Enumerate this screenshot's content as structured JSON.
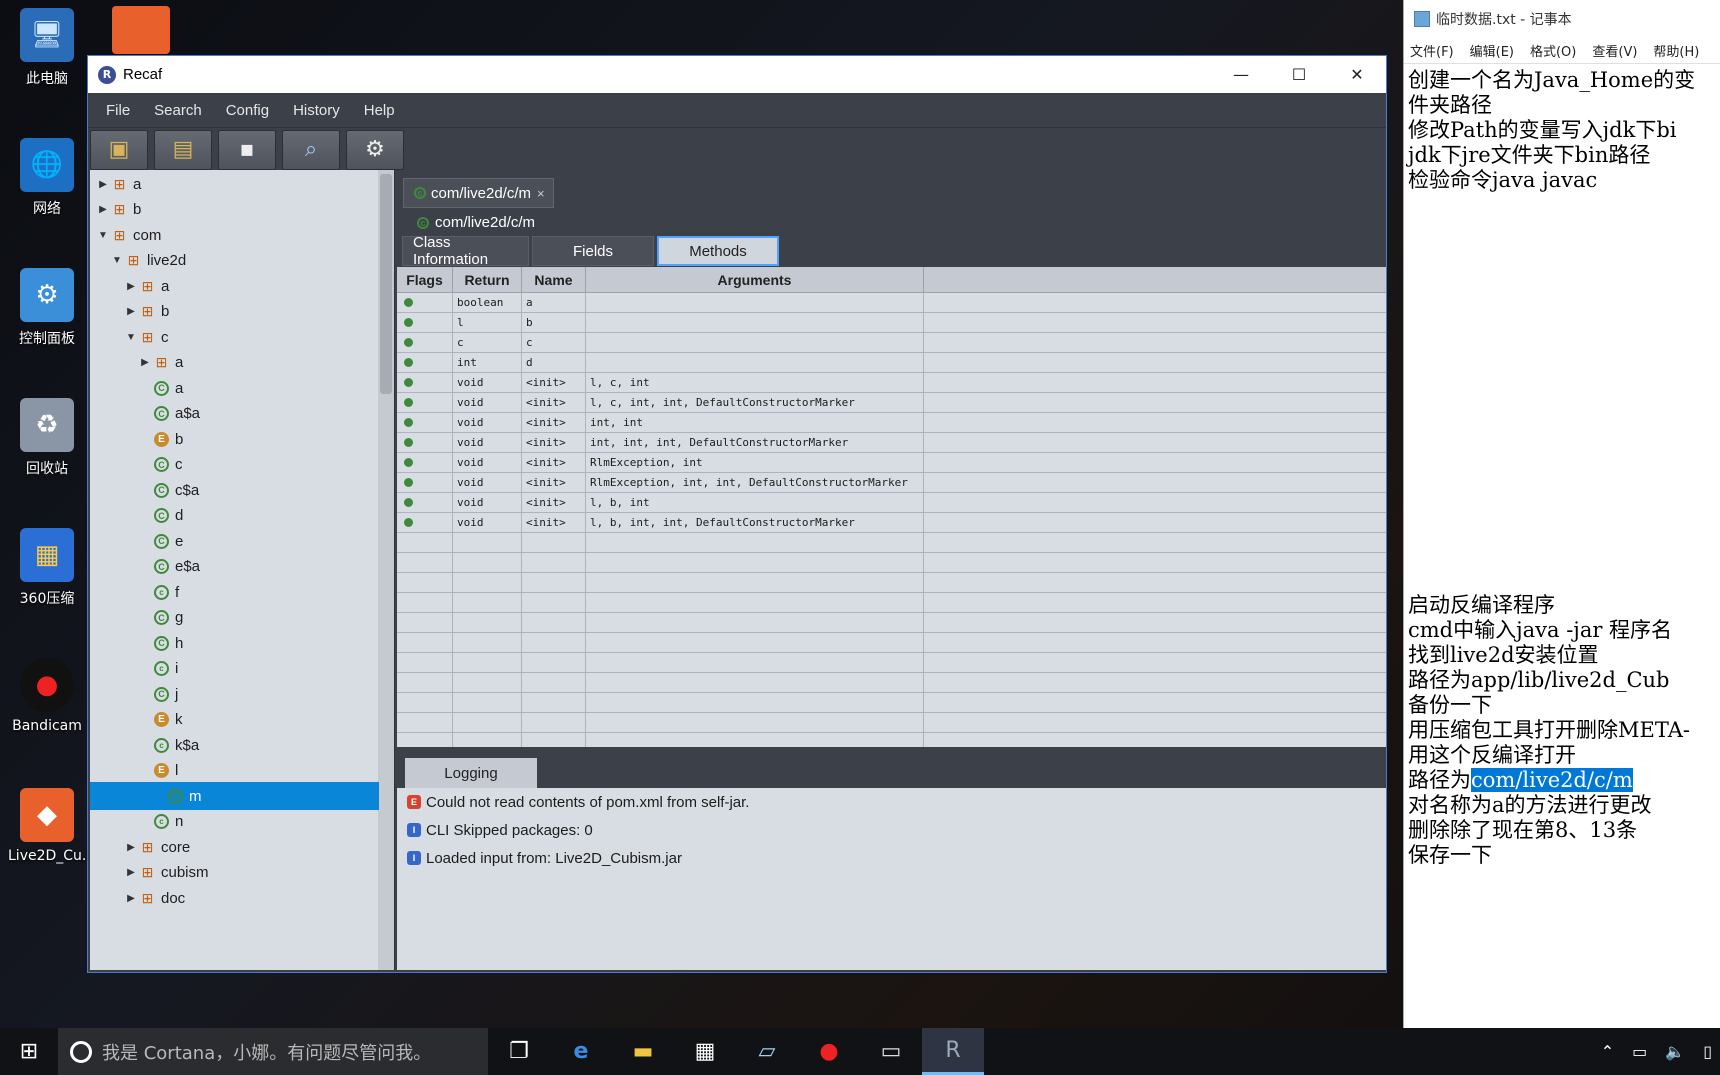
{
  "desktop": {
    "icons": [
      {
        "label": "此电脑",
        "icon": "computer-icon"
      },
      {
        "label": "网络",
        "icon": "network-icon"
      },
      {
        "label": "控制面板",
        "icon": "control-panel-icon"
      },
      {
        "label": "回收站",
        "icon": "recycle-bin-icon"
      },
      {
        "label": "360压缩",
        "icon": "archive-icon"
      },
      {
        "label": "Bandicam",
        "icon": "bandicam-icon"
      },
      {
        "label": "Live2D_Cu...",
        "icon": "live2d-icon"
      }
    ]
  },
  "recaf": {
    "title": "Recaf",
    "window_controls": {
      "minimize": "—",
      "maximize": "☐",
      "close": "✕"
    },
    "menu": [
      "File",
      "Search",
      "Config",
      "History",
      "Help"
    ],
    "toolbar": [
      "load-jar",
      "save-jar",
      "save",
      "search",
      "config"
    ],
    "tree": [
      {
        "label": "a",
        "type": "package",
        "depth": 0,
        "expanded": false
      },
      {
        "label": "b",
        "type": "package",
        "depth": 0,
        "expanded": false
      },
      {
        "label": "com",
        "type": "package",
        "depth": 0,
        "expanded": true
      },
      {
        "label": "live2d",
        "type": "package",
        "depth": 1,
        "expanded": true
      },
      {
        "label": "a",
        "type": "package",
        "depth": 2,
        "expanded": false
      },
      {
        "label": "b",
        "type": "package",
        "depth": 2,
        "expanded": false
      },
      {
        "label": "c",
        "type": "package",
        "depth": 2,
        "expanded": true
      },
      {
        "label": "a",
        "type": "package",
        "depth": 3,
        "expanded": false
      },
      {
        "label": "a",
        "type": "class",
        "depth": 3
      },
      {
        "label": "a$a",
        "type": "class",
        "depth": 3
      },
      {
        "label": "b",
        "type": "enum",
        "depth": 3
      },
      {
        "label": "c",
        "type": "class",
        "depth": 3
      },
      {
        "label": "c$a",
        "type": "class",
        "depth": 3
      },
      {
        "label": "d",
        "type": "class",
        "depth": 3
      },
      {
        "label": "e",
        "type": "class",
        "depth": 3
      },
      {
        "label": "e$a",
        "type": "class",
        "depth": 3
      },
      {
        "label": "f",
        "type": "inner",
        "depth": 3
      },
      {
        "label": "g",
        "type": "class",
        "depth": 3
      },
      {
        "label": "h",
        "type": "class",
        "depth": 3
      },
      {
        "label": "i",
        "type": "inner",
        "depth": 3
      },
      {
        "label": "j",
        "type": "class",
        "depth": 3
      },
      {
        "label": "k",
        "type": "enum",
        "depth": 3
      },
      {
        "label": "k$a",
        "type": "inner",
        "depth": 3
      },
      {
        "label": "l",
        "type": "enum",
        "depth": 3
      },
      {
        "label": "m",
        "type": "class",
        "depth": 3,
        "selected": true
      },
      {
        "label": "n",
        "type": "inner",
        "depth": 3
      },
      {
        "label": "core",
        "type": "package",
        "depth": 2,
        "expanded": false
      },
      {
        "label": "cubism",
        "type": "package",
        "depth": 2,
        "expanded": false
      },
      {
        "label": "doc",
        "type": "package",
        "depth": 2,
        "expanded": false
      }
    ],
    "editor": {
      "tab_label": "com/live2d/c/m",
      "tab_close": "×",
      "breadcrumb": "com/live2d/c/m",
      "subtabs": [
        "Class Information",
        "Fields",
        "Methods"
      ],
      "active_subtab": "Methods",
      "columns": [
        "Flags",
        "Return",
        "Name",
        "Arguments",
        ""
      ],
      "methods": [
        {
          "return": "boolean",
          "name": "a",
          "args": ""
        },
        {
          "return": "l",
          "name": "b",
          "args": ""
        },
        {
          "return": "c",
          "name": "c",
          "args": ""
        },
        {
          "return": "int",
          "name": "d",
          "args": ""
        },
        {
          "return": "void",
          "name": "<init>",
          "args": "l, c, int"
        },
        {
          "return": "void",
          "name": "<init>",
          "args": "l, c, int, int, DefaultConstructorMarker"
        },
        {
          "return": "void",
          "name": "<init>",
          "args": "int, int"
        },
        {
          "return": "void",
          "name": "<init>",
          "args": "int, int, int, DefaultConstructorMarker"
        },
        {
          "return": "void",
          "name": "<init>",
          "args": "RlmException, int"
        },
        {
          "return": "void",
          "name": "<init>",
          "args": "RlmException, int, int, DefaultConstructorMarker"
        },
        {
          "return": "void",
          "name": "<init>",
          "args": "l, b, int"
        },
        {
          "return": "void",
          "name": "<init>",
          "args": "l, b, int, int, DefaultConstructorMarker"
        }
      ]
    },
    "logging": {
      "tab_label": "Logging",
      "lines": [
        {
          "level": "error",
          "badge": "E",
          "text": "Could not read contents of pom.xml from self-jar."
        },
        {
          "level": "info",
          "badge": "I",
          "text": "CLI Skipped packages: 0"
        },
        {
          "level": "info",
          "badge": "I",
          "text": "Loaded input from: Live2D_Cubism.jar"
        }
      ]
    }
  },
  "notepad": {
    "title": "临时数据.txt - 记事本",
    "menu": [
      "文件(F)",
      "编辑(E)",
      "格式(O)",
      "查看(V)",
      "帮助(H)"
    ],
    "lines_top": [
      "创建一个名为Java_Home的变",
      "件夹路径",
      "修改Path的变量写入jdk下bi",
      "jdk下jre文件夹下bin路径",
      "检验命令java javac"
    ],
    "lines_bottom_a": [
      "启动反编译程序",
      "cmd中输入java -jar 程序名",
      "找到live2d安装位置",
      "路径为app/lib/live2d_Cub",
      "备份一下",
      "用压缩包工具打开删除META-",
      "用这个反编译打开"
    ],
    "highlight_prefix": "路径为",
    "highlight_text": "com/live2d/c/m",
    "lines_bottom_b": [
      "对名称为a的方法进行更改",
      "删除除了现在第8、13条",
      "保存一下"
    ]
  },
  "taskbar": {
    "search_placeholder": "我是 Cortana，小娜。有问题尽管问我。",
    "apps": [
      "task-view-icon",
      "edge-icon",
      "file-explorer-icon",
      "store-icon",
      "notepad-icon",
      "record-icon",
      "terminal-icon",
      "recaf-icon"
    ]
  }
}
